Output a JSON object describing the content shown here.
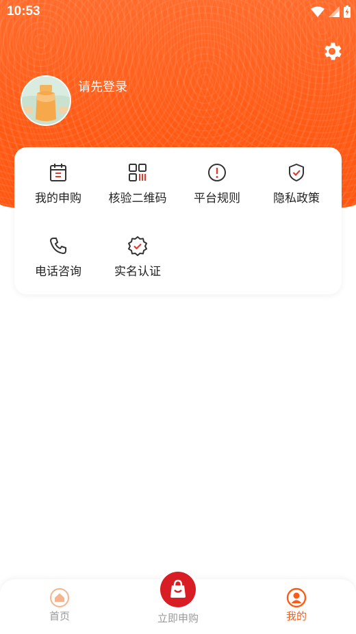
{
  "status_bar": {
    "time": "10:53"
  },
  "header": {
    "login_prompt": "请先登录"
  },
  "menu": {
    "items": [
      {
        "label": "我的申购",
        "icon": "calendar-list-icon"
      },
      {
        "label": "核验二维码",
        "icon": "qr-code-icon"
      },
      {
        "label": "平台规则",
        "icon": "exclamation-circle-icon"
      },
      {
        "label": "隐私政策",
        "icon": "shield-check-icon"
      },
      {
        "label": "电话咨询",
        "icon": "phone-icon"
      },
      {
        "label": "实名认证",
        "icon": "verified-badge-icon"
      }
    ]
  },
  "tabbar": {
    "tabs": [
      {
        "label": "首页",
        "icon": "home-icon",
        "active": false
      },
      {
        "label": "立即申购",
        "icon": "shopping-bag-icon",
        "active": false
      },
      {
        "label": "我的",
        "icon": "user-icon",
        "active": true
      }
    ]
  },
  "colors": {
    "accent": "#ff5a14",
    "brand_red": "#d81e24",
    "icon_red": "#e03a2e",
    "tab_inactive": "#999999",
    "tab_active": "#ff5a14"
  }
}
